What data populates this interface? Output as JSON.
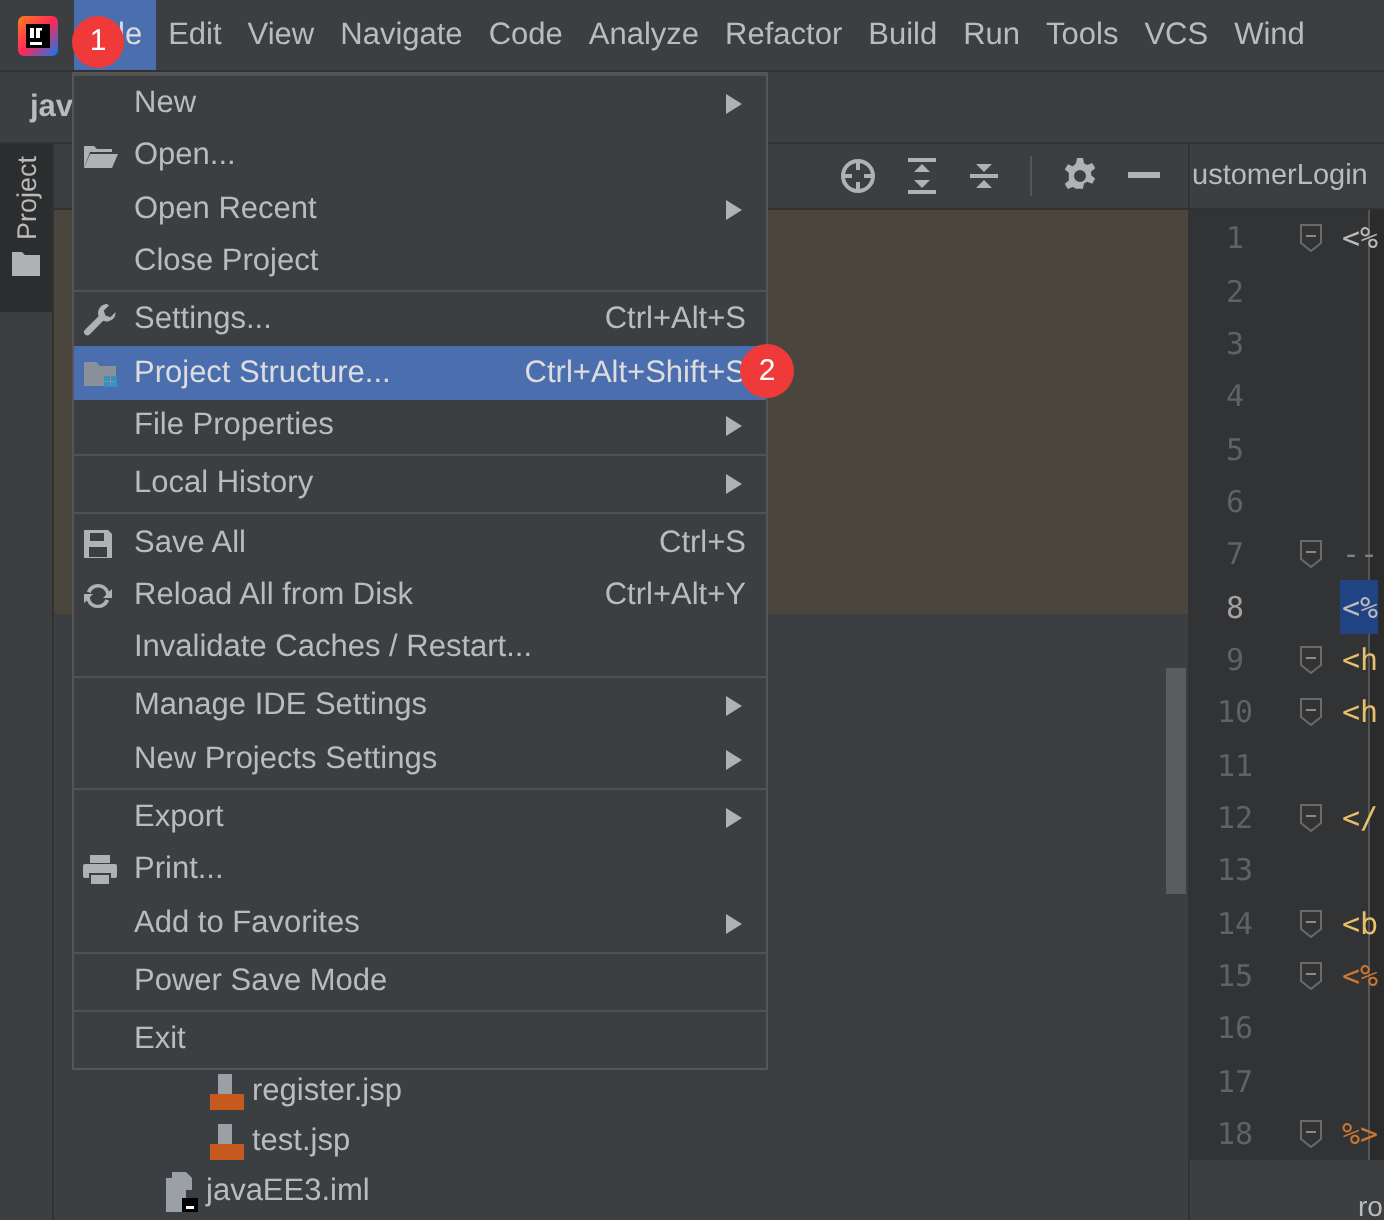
{
  "menubar": {
    "badge": "1",
    "items": [
      {
        "label": "le",
        "selected": true
      },
      {
        "label": "Edit",
        "selected": false
      },
      {
        "label": "View",
        "selected": false
      },
      {
        "label": "Navigate",
        "selected": false
      },
      {
        "label": "Code",
        "selected": false
      },
      {
        "label": "Analyze",
        "selected": false
      },
      {
        "label": "Refactor",
        "selected": false
      },
      {
        "label": "Build",
        "selected": false
      },
      {
        "label": "Run",
        "selected": false
      },
      {
        "label": "Tools",
        "selected": false
      },
      {
        "label": "VCS",
        "selected": false
      },
      {
        "label": "Wind",
        "selected": false
      }
    ]
  },
  "navbar": {
    "title": "jav"
  },
  "tool_window_stripe": {
    "label": "Project"
  },
  "file_menu": {
    "badge": "2",
    "groups": [
      [
        {
          "label": "New",
          "submenu": true,
          "selected": false
        },
        {
          "label": "Open...",
          "submenu": false,
          "selected": false
        },
        {
          "label": "Open Recent",
          "submenu": true,
          "selected": false
        },
        {
          "label": "Close Project",
          "submenu": false,
          "selected": false
        }
      ],
      [
        {
          "label": "Settings...",
          "shortcut": "Ctrl+Alt+S",
          "submenu": false,
          "selected": false
        },
        {
          "label": "Project Structure...",
          "shortcut": "Ctrl+Alt+Shift+S",
          "submenu": false,
          "selected": true
        },
        {
          "label": "File Properties",
          "submenu": true,
          "selected": false
        }
      ],
      [
        {
          "label": "Local History",
          "submenu": true,
          "selected": false
        }
      ],
      [
        {
          "label": "Save All",
          "shortcut": "Ctrl+S",
          "submenu": false,
          "selected": false
        },
        {
          "label": "Reload All from Disk",
          "shortcut": "Ctrl+Alt+Y",
          "submenu": false,
          "selected": false
        },
        {
          "label": "Invalidate Caches / Restart...",
          "submenu": false,
          "selected": false
        }
      ],
      [
        {
          "label": "Manage IDE Settings",
          "submenu": true,
          "selected": false
        },
        {
          "label": "New Projects Settings",
          "submenu": true,
          "selected": false
        }
      ],
      [
        {
          "label": "Export",
          "submenu": true,
          "selected": false
        },
        {
          "label": "Print...",
          "submenu": false,
          "selected": false
        },
        {
          "label": "Add to Favorites",
          "submenu": true,
          "selected": false
        }
      ],
      [
        {
          "label": "Power Save Mode",
          "submenu": false,
          "selected": false
        }
      ],
      [
        {
          "label": "Exit",
          "submenu": false,
          "selected": false
        }
      ]
    ]
  },
  "project_tree": {
    "items": [
      {
        "name": "register.jsp",
        "kind": "jsp"
      },
      {
        "name": "test.jsp",
        "kind": "jsp"
      },
      {
        "name": "javaEE3.iml",
        "kind": "iml"
      }
    ]
  },
  "editor": {
    "tab": "ustomerLogin",
    "breadcrumb": "ro",
    "lines": [
      {
        "number": "1",
        "code": "<%",
        "kind": "directive",
        "fold": true,
        "selected": false
      },
      {
        "number": "2",
        "selected": false,
        "fold": false
      },
      {
        "number": "3",
        "selected": false,
        "fold": false
      },
      {
        "number": "4",
        "selected": false,
        "fold": false
      },
      {
        "number": "5",
        "selected": false,
        "fold": false
      },
      {
        "number": "6",
        "selected": false,
        "fold": false
      },
      {
        "number": "7",
        "code": "--",
        "kind": "comment",
        "fold": true,
        "selected": false
      },
      {
        "number": "8",
        "code": "<%",
        "kind": "directive",
        "fold": false,
        "selected": true
      },
      {
        "number": "9",
        "code": "<h",
        "kind": "tag",
        "fold": true,
        "selected": false
      },
      {
        "number": "10",
        "code": "<h",
        "kind": "tag",
        "fold": true,
        "selected": false
      },
      {
        "number": "11",
        "selected": false,
        "fold": false
      },
      {
        "number": "12",
        "code": "</",
        "kind": "tag",
        "fold": true,
        "selected": false
      },
      {
        "number": "13",
        "selected": false,
        "fold": false
      },
      {
        "number": "14",
        "code": "<b",
        "kind": "tag",
        "fold": true,
        "selected": false
      },
      {
        "number": "15",
        "code": "<%",
        "kind": "scriptlet",
        "fold": true,
        "selected": false
      },
      {
        "number": "16",
        "selected": false,
        "fold": false
      },
      {
        "number": "17",
        "selected": false,
        "fold": false
      },
      {
        "number": "18",
        "code": "%>",
        "kind": "scriptlet",
        "fold": true,
        "selected": false
      }
    ]
  }
}
